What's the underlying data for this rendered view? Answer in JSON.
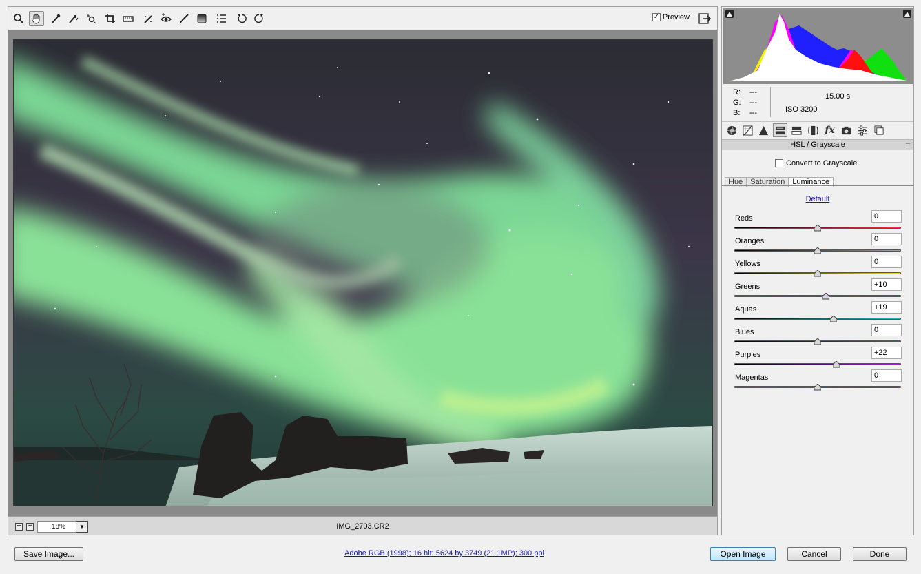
{
  "toolbar": {
    "tools": [
      "zoom-tool",
      "hand-tool",
      "white-balance-tool",
      "color-sampler-tool",
      "targeted-adjustment-tool",
      "crop-tool",
      "straighten-tool",
      "spot-removal-tool",
      "red-eye-removal-tool",
      "adjustment-brush-tool",
      "graduated-filter-tool",
      "preferences-tool",
      "rotate-left-tool",
      "rotate-right-tool"
    ],
    "preview_label": "Preview",
    "preview_checked": true
  },
  "status": {
    "zoom": "18%",
    "filename": "IMG_2703.CR2",
    "zoom_out": "−",
    "zoom_in": "+"
  },
  "info": {
    "r_label": "R:",
    "r_value": "---",
    "g_label": "G:",
    "g_value": "---",
    "b_label": "B:",
    "b_value": "---",
    "shutter": "15.00 s",
    "iso": "ISO 3200"
  },
  "panel": {
    "title": "HSL / Grayscale",
    "convert_label": "Convert to Grayscale",
    "tabs": [
      "Hue",
      "Saturation",
      "Luminance"
    ],
    "active_tab": "Luminance",
    "default_link": "Default"
  },
  "sliders": [
    {
      "label": "Reds",
      "value": "0",
      "level": 0
    },
    {
      "label": "Oranges",
      "value": "0",
      "level": 0
    },
    {
      "label": "Yellows",
      "value": "0",
      "level": 0
    },
    {
      "label": "Greens",
      "value": "+10",
      "level": 10
    },
    {
      "label": "Aquas",
      "value": "+19",
      "level": 19
    },
    {
      "label": "Blues",
      "value": "0",
      "level": 0
    },
    {
      "label": "Purples",
      "value": "+22",
      "level": 22
    },
    {
      "label": "Magentas",
      "value": "0",
      "level": 0
    }
  ],
  "bottom": {
    "save_label": "Save Image...",
    "workflow": "Adobe RGB (1998); 16 bit; 5624 by 3749 (21.1MP); 300 ppi",
    "open_label": "Open Image",
    "cancel_label": "Cancel",
    "done_label": "Done"
  },
  "colors": {
    "reds": "#e0202a",
    "oranges": "#e07a20",
    "yellows": "#d8d020",
    "greens": "#30c030",
    "aquas": "#20c0c0",
    "blues": "#2060e0",
    "purples": "#a020e0",
    "magentas": "#e020c0"
  }
}
